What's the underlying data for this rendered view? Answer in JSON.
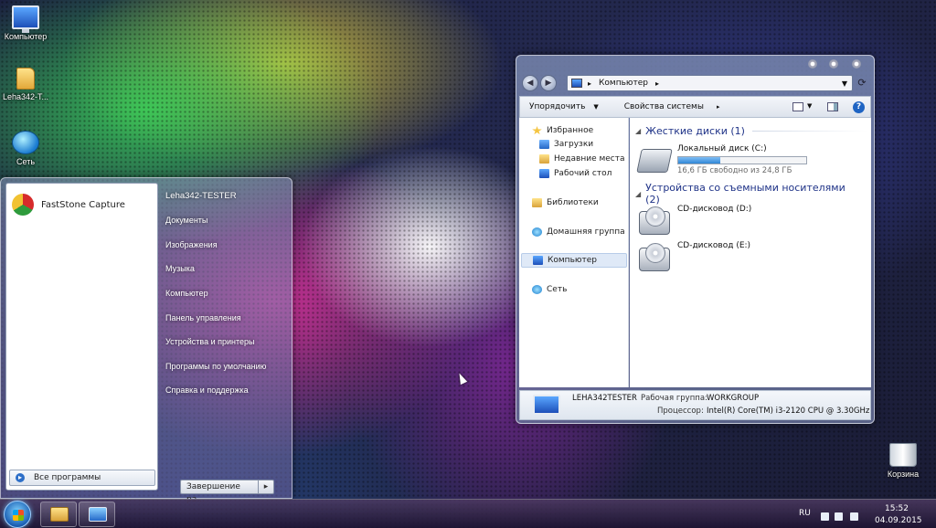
{
  "desktop": {
    "icons": [
      {
        "label": "Компьютер",
        "icon": "computer-icon"
      },
      {
        "label": "Leha342-T...",
        "icon": "user-folder-icon"
      },
      {
        "label": "Сеть",
        "icon": "network-icon"
      },
      {
        "label": "Корзина",
        "icon": "recycle-bin-icon"
      }
    ]
  },
  "start_menu": {
    "pinned": [
      {
        "label": "FastStone Capture",
        "icon": "faststone-capture-icon"
      }
    ],
    "all_programs": "Все программы",
    "right_links": [
      "Leha342-TESTER",
      "Документы",
      "Изображения",
      "Музыка",
      "Компьютер",
      "Панель управления",
      "Устройства и принтеры",
      "Программы по умолчанию",
      "Справка и поддержка"
    ],
    "shutdown": "Завершение ра..."
  },
  "explorer": {
    "address": "Компьютер",
    "toolbar": {
      "organize": "Упорядочить",
      "system_properties": "Свойства системы"
    },
    "nav": {
      "favorites": "Избранное",
      "downloads": "Загрузки",
      "recent": "Недавние места",
      "desktop": "Рабочий стол",
      "libraries": "Библиотеки",
      "homegroup": "Домашняя группа",
      "computer": "Компьютер",
      "network": "Сеть"
    },
    "groups": {
      "hard_disks": "Жесткие диски (1)",
      "removable": "Устройства со съемными носителями (2)"
    },
    "drives": {
      "c_name": "Локальный диск (C:)",
      "c_free": "16,6 ГБ свободно из 24,8 ГБ",
      "c_used_fraction": 0.33,
      "d_name": "CD-дисковод (D:)",
      "e_name": "CD-дисковод (E:)"
    },
    "details": {
      "computer_name": "LEHA342TESTER",
      "workgroup_label": "Рабочая группа:",
      "workgroup_value": "WORKGROUP",
      "cpu_label": "Процессор:",
      "cpu_value": "Intel(R) Core(TM) i3-2120 CPU @ 3.30GHz"
    }
  },
  "taskbar": {
    "language": "RU",
    "time": "15:52",
    "date": "04.09.2015"
  }
}
